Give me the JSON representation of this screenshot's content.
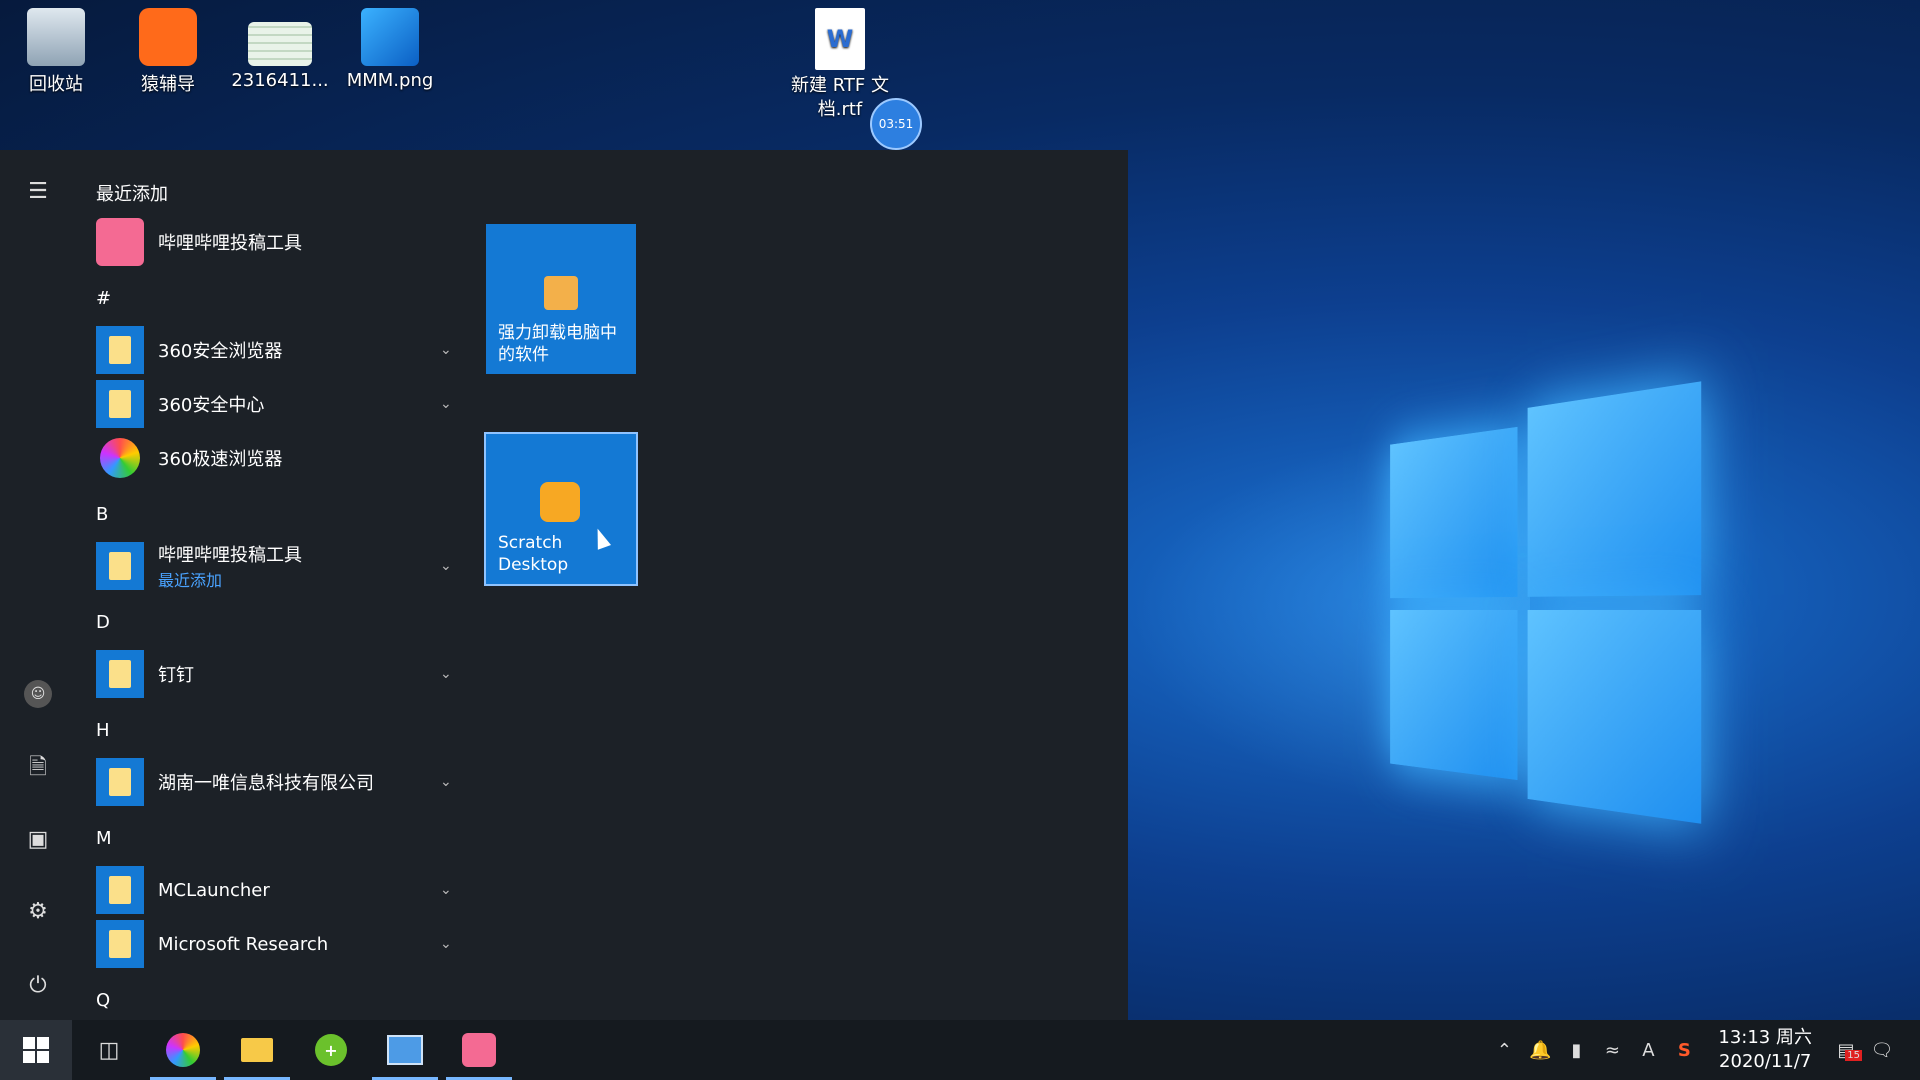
{
  "desktop": {
    "icons": [
      {
        "label": "回收站"
      },
      {
        "label": "猿辅导"
      },
      {
        "label": "2316411..."
      },
      {
        "label": "MMM.png"
      },
      {
        "label": "新建 RTF 文\n档.rtf"
      }
    ],
    "timer_badge": "03:51"
  },
  "start_menu": {
    "recent_header": "最近添加",
    "recent_item": "哔哩哔哩投稿工具",
    "sections": {
      "hash": "#",
      "b": "B",
      "d": "D",
      "h": "H",
      "m": "M",
      "q": "Q"
    },
    "apps": [
      {
        "label": "360安全浏览器"
      },
      {
        "label": "360安全中心"
      },
      {
        "label": "360极速浏览器"
      },
      {
        "label": "哔哩哔哩投稿工具",
        "sub": "最近添加"
      },
      {
        "label": "钉钉"
      },
      {
        "label": "湖南一唯信息科技有限公司"
      },
      {
        "label": "MCLauncher"
      },
      {
        "label": "Microsoft Research"
      }
    ],
    "tiles": [
      {
        "label": "强力卸载电脑中\n的软件"
      },
      {
        "label": "Scratch\nDesktop"
      }
    ]
  },
  "taskbar": {
    "clock_time": "13:13 周六",
    "clock_date": "2020/11/7",
    "ime": "A",
    "notif_count": "15"
  },
  "colors": {
    "accent": "#1479d4",
    "menu_bg": "#1c2127",
    "taskbar_bg": "#151a1f"
  }
}
